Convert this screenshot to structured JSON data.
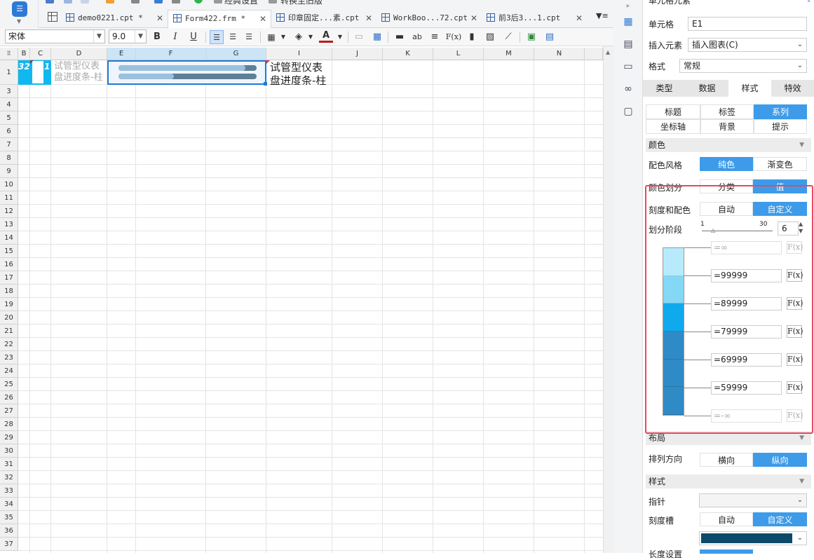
{
  "window": {
    "top_strip_items": [
      "经典设置",
      "转换至旧版"
    ]
  },
  "tabs": [
    {
      "label": "demo0221.cpt *",
      "active": false
    },
    {
      "label": "Form422.frm *",
      "active": true
    },
    {
      "label": "印章固定...素.cpt",
      "active": false
    },
    {
      "label": "WorkBoo...72.cpt",
      "active": false
    },
    {
      "label": "前3后3...1.cpt",
      "active": false
    }
  ],
  "tab_close": "✕",
  "toolbar": {
    "font_name": "宋体",
    "font_size": "9.0",
    "bold": "B",
    "italic": "I",
    "underline": "U",
    "text_ab": "ab",
    "fx": "F(x)",
    "font_color_a": "A"
  },
  "sheet": {
    "columns": [
      "B",
      "C",
      "D",
      "E",
      "F",
      "G",
      "I",
      "J",
      "K",
      "L",
      "M",
      "N"
    ],
    "rows": [
      "1",
      "3",
      "4",
      "5",
      "6",
      "7",
      "8",
      "9",
      "10",
      "11",
      "12",
      "13",
      "14",
      "15",
      "16",
      "17",
      "18",
      "19",
      "20",
      "21",
      "22",
      "23",
      "24",
      "25",
      "26",
      "27",
      "28",
      "29",
      "30",
      "31",
      "32",
      "33",
      "34",
      "35",
      "36",
      "37"
    ],
    "cells": {
      "b1": "32",
      "c1": "1",
      "d1_line1": "试管型仪表",
      "d1_line2": "盘进度条-柱",
      "i1_line1": "试管型仪表",
      "i1_line2": "盘进度条-柱"
    },
    "progress_bars": [
      0.92,
      0.4
    ]
  },
  "panel": {
    "title": "单元格元素",
    "cell_label": "单元格",
    "cell_value": "E1",
    "insert_label": "插入元素",
    "insert_value": "插入图表(C)",
    "format_label": "格式",
    "format_value": "常规",
    "tabs": [
      "类型",
      "数据",
      "样式",
      "特效"
    ],
    "active_tab": "样式",
    "subtabs_row1": [
      "标题",
      "标签",
      "系列"
    ],
    "subtabs_row2": [
      "坐标轴",
      "背景",
      "提示"
    ],
    "active_subtab": "系列",
    "color_section": "颜色",
    "color_style_label": "配色风格",
    "color_style_options": [
      "纯色",
      "渐变色"
    ],
    "color_style_selected": "纯色",
    "color_divide_label": "颜色划分",
    "color_divide_options": [
      "分类",
      "值"
    ],
    "color_divide_selected": "值",
    "scale_color_label": "刻度和配色",
    "scale_color_options": [
      "自动",
      "自定义"
    ],
    "scale_color_selected": "自定义",
    "stage_label": "划分阶段",
    "stage_min": "1",
    "stage_max": "30",
    "stage_value": "6",
    "bounds": [
      "=∞",
      "=99999",
      "=89999",
      "=79999",
      "=69999",
      "=59999",
      "=-∞"
    ],
    "band_colors": [
      "#b7ebfb",
      "#83d8f6",
      "#10a9ee",
      "#2f8bc6",
      "#2f8bc6",
      "#2f8bc6"
    ],
    "fx_label": "F(x)",
    "layout_section": "布局",
    "direction_label": "排列方向",
    "direction_options": [
      "横向",
      "纵向"
    ],
    "direction_selected": "纵向",
    "style_section": "样式",
    "pointer_label": "指针",
    "groove_label": "刻度槽",
    "groove_options": [
      "自动",
      "自定义"
    ],
    "groove_selected": "自定义",
    "groove_color": "#0d4a6a",
    "length_label": "长度设置"
  },
  "colors": {
    "accent": "#3d9be9",
    "highlight_border": "#e8475f",
    "selection": "#1f7ad6"
  }
}
